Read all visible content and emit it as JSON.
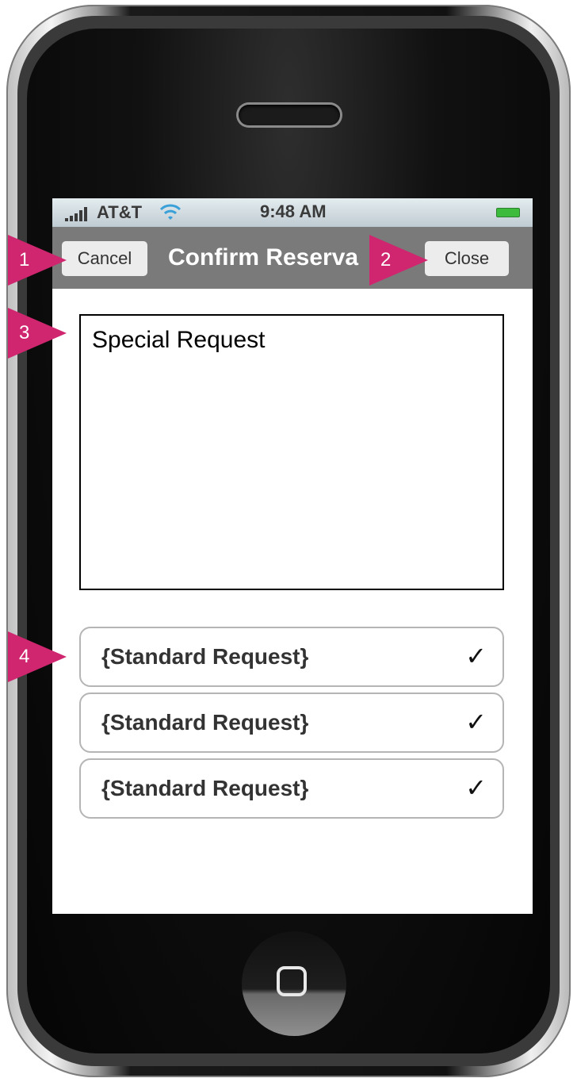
{
  "status_bar": {
    "carrier": "AT&T",
    "time": "9:48 AM"
  },
  "nav": {
    "cancel_label": "Cancel",
    "title": "Confirm Reserva",
    "close_label": "Close"
  },
  "special_request": {
    "label": "Special Request"
  },
  "standard_requests": [
    {
      "label": "{Standard Request}",
      "check": "✓"
    },
    {
      "label": "{Standard Request}",
      "check": "✓"
    },
    {
      "label": "{Standard Request}",
      "check": "✓"
    }
  ],
  "annotations": [
    "1",
    "2",
    "3",
    "4"
  ],
  "colors": {
    "annotation": "#d0266f",
    "navbar": "#7a7a7a",
    "battery": "#3dbb3d"
  }
}
